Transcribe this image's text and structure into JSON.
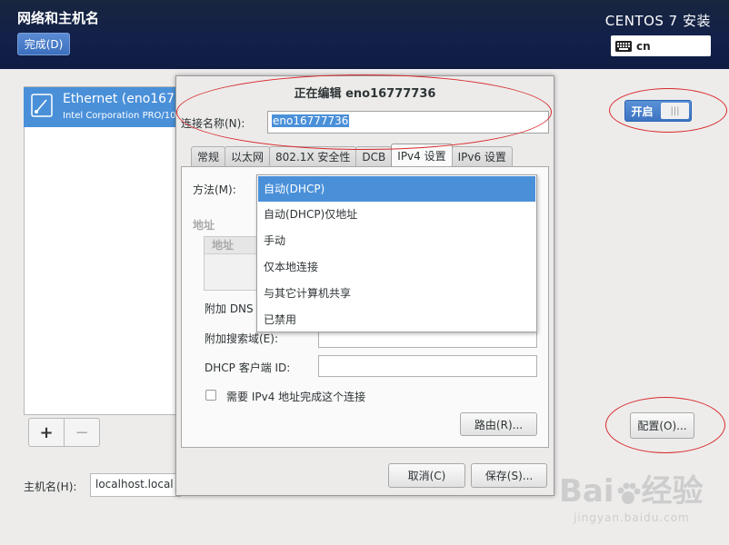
{
  "header": {
    "title": "网络和主机名",
    "done_label": "完成(D)",
    "product": "CENTOS 7 安装",
    "keyboard_layout": "cn"
  },
  "devices": {
    "items": [
      {
        "name": "Ethernet (eno167",
        "detail": "Intel Corporation PRO/10"
      }
    ],
    "add_label": "+",
    "remove_label": "−"
  },
  "hostname": {
    "label": "主机名(H):",
    "value": "localhost.local"
  },
  "right": {
    "switch_label": "开启",
    "switch_knob": "|||",
    "config_label": "配置(O)..."
  },
  "dialog": {
    "title": "正在编辑 eno16777736",
    "connection_name_label": "连接名称(N):",
    "connection_name_value": "eno16777736",
    "tabs": [
      {
        "label": "常规"
      },
      {
        "label": "以太网"
      },
      {
        "label": "802.1X 安全性"
      },
      {
        "label": "DCB"
      },
      {
        "label": "IPv4 设置",
        "active": true
      },
      {
        "label": "IPv6 设置"
      }
    ],
    "method_label": "方法(M):",
    "method_options": [
      "自动(DHCP)",
      "自动(DHCP)仅地址",
      "手动",
      "仅本地连接",
      "与其它计算机共享",
      "已禁用"
    ],
    "address_label": "地址",
    "address_column": "地址",
    "dns_label": "附加 DNS",
    "search_domain_label": "附加搜索域(E):",
    "dhcp_client_id_label": "DHCP 客户端 ID:",
    "require_ipv4_label": "需要 IPv4 地址完成这个连接",
    "routes_label": "路由(R)...",
    "cancel_label": "取消(C)",
    "save_label": "保存(S)..."
  },
  "watermark": {
    "brand": "Bai",
    "brand2": "经验",
    "url": "jingyan.baidu.com"
  },
  "colors": {
    "header_bg": "#12204a",
    "accent": "#4a90d9",
    "annotation": "#d9292c"
  }
}
